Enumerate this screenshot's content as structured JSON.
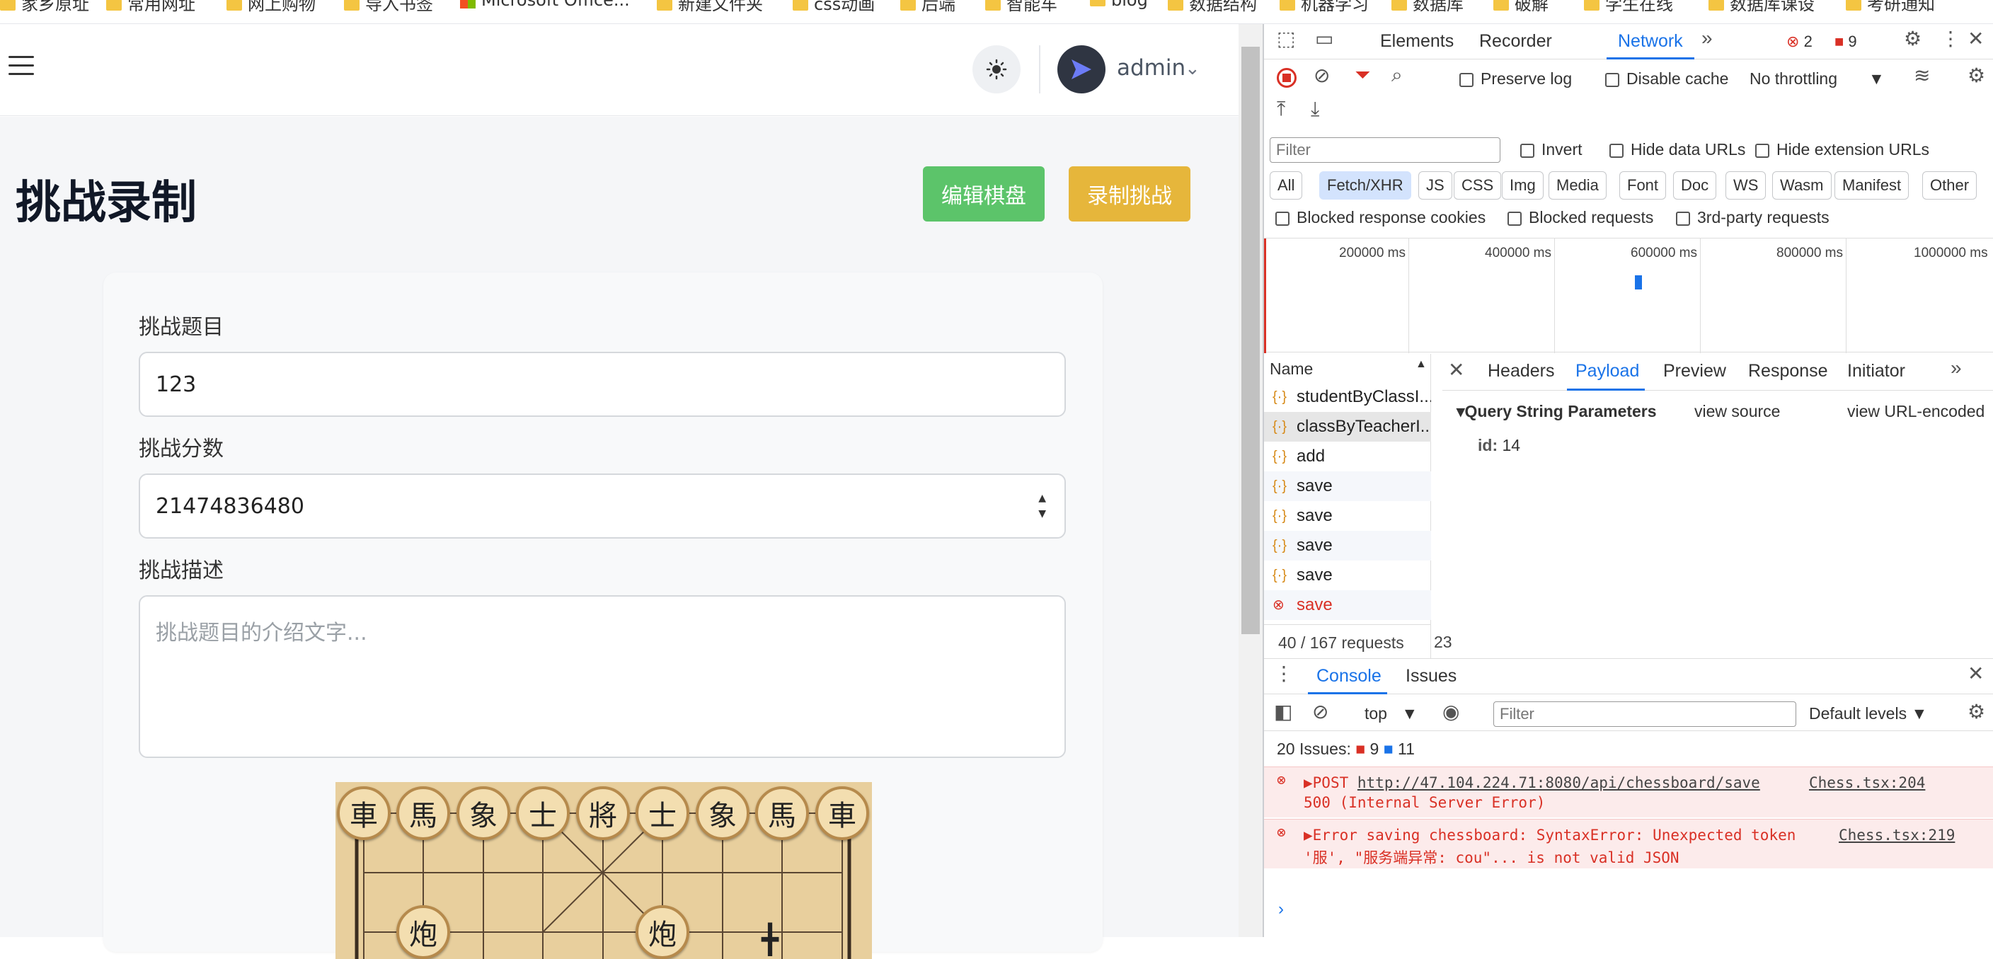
{
  "bookmarks": [
    "家乡原址",
    "常用网址",
    "网上购物",
    "导入书签",
    "Microsoft Office...",
    "新建文件夹",
    "css动画",
    "后端",
    "智能车",
    "blog",
    "数据结构",
    "机器学习",
    "数据库",
    "破解",
    "学生在线",
    "数据库课设",
    "考研通知"
  ],
  "app": {
    "user_name": "admin",
    "page_title": "挑战录制",
    "edit_board_label": "编辑棋盘",
    "record_label": "录制挑战",
    "form": {
      "title_label": "挑战题目",
      "title_value": "123",
      "score_label": "挑战分数",
      "score_value": "21474836480",
      "desc_label": "挑战描述",
      "desc_placeholder": "挑战题目的介绍文字..."
    },
    "board_top_row": [
      "車",
      "馬",
      "象",
      "士",
      "將",
      "士",
      "象",
      "馬",
      "車"
    ],
    "board_second_row": [
      "炮",
      "炮"
    ]
  },
  "devtools": {
    "tabs": [
      "Elements",
      "Recorder",
      "Network"
    ],
    "active_tab": "Network",
    "error_count": "2",
    "warning_count": "9",
    "preserve_log": "Preserve log",
    "disable_cache": "Disable cache",
    "throttling": "No throttling",
    "filter_placeholder": "Filter",
    "invert": "Invert",
    "hide_data_urls": "Hide data URLs",
    "hide_ext_urls": "Hide extension URLs",
    "type_filters": [
      "All",
      "Fetch/XHR",
      "JS",
      "CSS",
      "Img",
      "Media",
      "Font",
      "Doc",
      "WS",
      "Wasm",
      "Manifest",
      "Other"
    ],
    "blocked_cookies": "Blocked response cookies",
    "blocked_requests": "Blocked requests",
    "third_party": "3rd-party requests",
    "timeline_labels": [
      "200000 ms",
      "400000 ms",
      "600000 ms",
      "800000 ms",
      "1000000 ms"
    ],
    "name_header": "Name",
    "requests": [
      {
        "name": "studentByClassI..."
      },
      {
        "name": "classByTeacherI..."
      },
      {
        "name": "add"
      },
      {
        "name": "save"
      },
      {
        "name": "save"
      },
      {
        "name": "save"
      },
      {
        "name": "save"
      },
      {
        "name": "save"
      }
    ],
    "request_count": "40 / 167 requests",
    "request_size": "23",
    "detail_tabs": [
      "Headers",
      "Payload",
      "Preview",
      "Response",
      "Initiator"
    ],
    "active_detail_tab": "Payload",
    "qsp_title": "Query String Parameters",
    "view_source": "view source",
    "view_url_encoded": "view URL-encoded",
    "param_key": "id:",
    "param_value": "14",
    "console_tabs": [
      "Console",
      "Issues"
    ],
    "context": "top",
    "console_filter": "Filter",
    "levels": "Default levels",
    "issues_label": "20 Issues:",
    "issues_errors": "9",
    "issues_info": "11",
    "log1_method": "POST",
    "log1_url": "http://47.104.224.71:8080/api/chessboard/save",
    "log1_status": "500 (Internal Server Error)",
    "log1_source": "Chess.tsx:204",
    "log2_text": "Error saving chessboard: SyntaxError: Unexpected token",
    "log2_text2": "'服', \"服务端异常: cou\"... is not valid JSON",
    "log2_source": "Chess.tsx:219"
  }
}
